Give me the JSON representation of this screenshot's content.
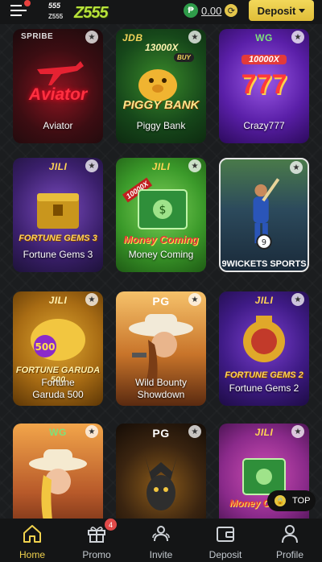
{
  "header": {
    "logo_small_top": "555",
    "logo_small_bottom": "Z555",
    "logo_big": "Z555",
    "currency_symbol": "₱",
    "balance": "0.00",
    "deposit_label": "Deposit"
  },
  "games": [
    {
      "title": "Aviator",
      "provider": "SPRIBE",
      "art": "Aviator"
    },
    {
      "title": "Piggy Bank",
      "provider": "JDB",
      "art": "PIGGY BANK",
      "multiplier": "13000X",
      "tag": "BUY"
    },
    {
      "title": "Crazy777",
      "provider": "WG",
      "art": "777",
      "multiplier": "10000X"
    },
    {
      "title": "Fortune Gems 3",
      "provider": "JILI",
      "art": "FORTUNE GEMS 3"
    },
    {
      "title": "Money Coming",
      "provider": "JILI",
      "art": "Money Coming",
      "multiplier": "10000X"
    },
    {
      "title": "",
      "provider": "",
      "art": "9WICKETS SPORTS"
    },
    {
      "title": "Fortune Garuda 500",
      "provider": "JILI",
      "art": "FORTUNE GARUDA 500"
    },
    {
      "title": "Wild Bounty Showdown",
      "provider": "PG",
      "art": ""
    },
    {
      "title": "Fortune Gems 2",
      "provider": "JILI",
      "art": "FORTUNE GEMS 2"
    },
    {
      "title": "",
      "provider": "WG",
      "art": ""
    },
    {
      "title": "",
      "provider": "PG",
      "art": ""
    },
    {
      "title": "",
      "provider": "JILI",
      "art": "Money Coming"
    }
  ],
  "top_button": {
    "label": "TOP"
  },
  "nav": [
    {
      "label": "Home",
      "icon": "home-icon"
    },
    {
      "label": "Promo",
      "icon": "gift-icon",
      "badge": "4"
    },
    {
      "label": "Invite",
      "icon": "users-icon"
    },
    {
      "label": "Deposit",
      "icon": "wallet-icon"
    },
    {
      "label": "Profile",
      "icon": "user-icon"
    }
  ],
  "colors": {
    "accent": "#e8c744",
    "background": "#1b1d1f",
    "badge": "#e14a49"
  }
}
